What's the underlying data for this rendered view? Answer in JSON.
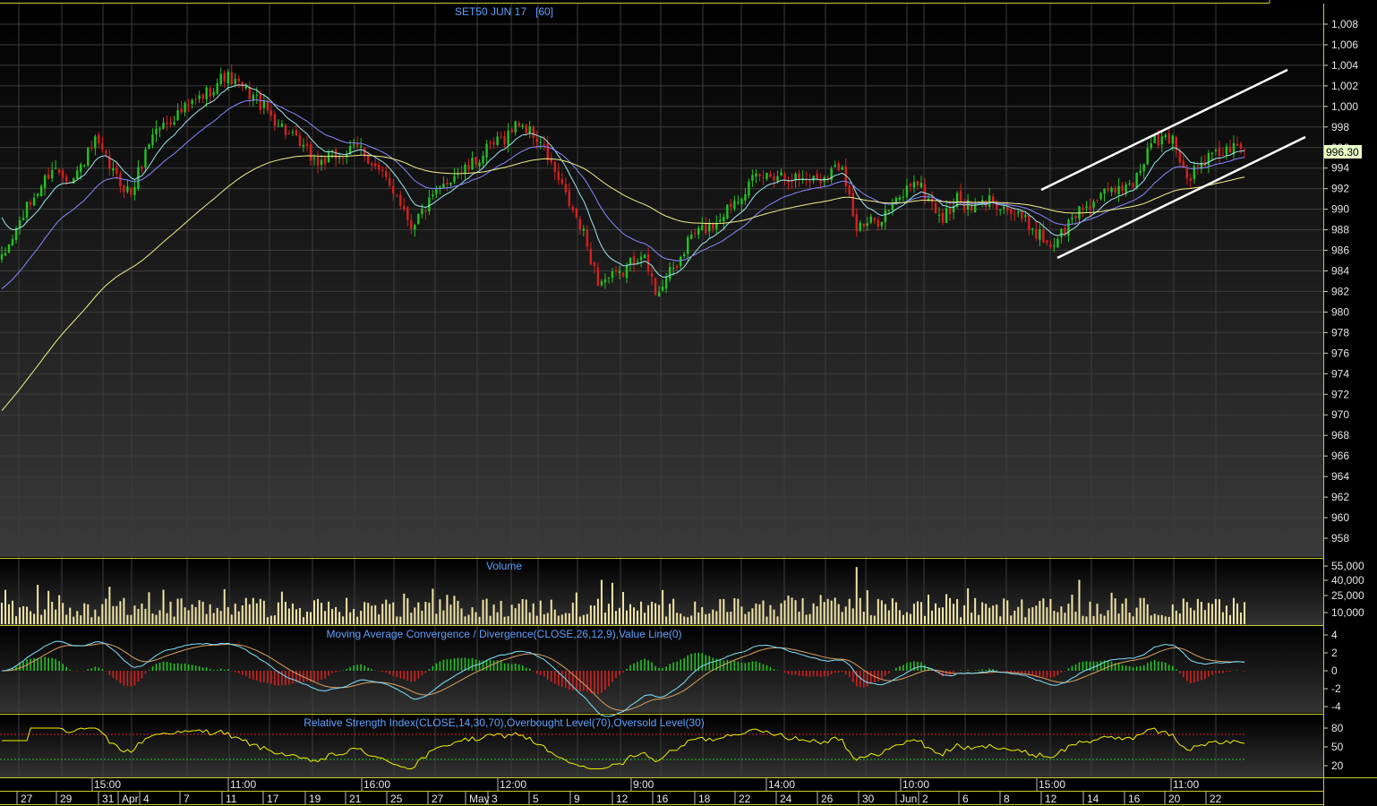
{
  "colors": {
    "background_top": "#000000",
    "background_bottom": "#3a3a3a",
    "up_candle": "#22c322",
    "down_candle": "#d61f1f",
    "grid": "#3c3c3c",
    "panel_border": "#cccc33",
    "title": "#5fa0ff",
    "ma_short": "#9ee7ef",
    "ma_mid": "#8888ff",
    "ma_long": "#f0f08a",
    "channel": "#ffffff",
    "volume": "#f2e6a6",
    "rsi": "#f0f000",
    "rsi_overbought": "#d61f1f",
    "rsi_oversold": "#22c322",
    "price_tag_bg": "#eaffc8"
  },
  "chart_data": [
    {
      "type": "candlestick",
      "title": "SET50 JUN 17   [60]",
      "ylim": [
        956.5,
        1009
      ],
      "y_ticks": [
        "1,008",
        "1,006",
        "1,004",
        "1,002",
        "1,000",
        "998",
        "996",
        "994",
        "992",
        "990",
        "988",
        "986",
        "984",
        "982",
        "980",
        "978",
        "976",
        "974",
        "972",
        "970",
        "968",
        "966",
        "964",
        "962",
        "960",
        "958"
      ],
      "last_price_label": "996.30",
      "close_path": [
        [
          0,
          985
        ],
        [
          6,
          989.5
        ],
        [
          14,
          994
        ],
        [
          20,
          993
        ],
        [
          26,
          996.5
        ],
        [
          32,
          993
        ],
        [
          36,
          991.5
        ],
        [
          42,
          997.5
        ],
        [
          50,
          999.5
        ],
        [
          56,
          1001
        ],
        [
          62,
          1003
        ],
        [
          70,
          1001
        ],
        [
          74,
          999.5
        ],
        [
          82,
          996.5
        ],
        [
          88,
          994.5
        ],
        [
          96,
          995.5
        ],
        [
          100,
          996
        ],
        [
          104,
          994
        ],
        [
          110,
          991.5
        ],
        [
          114,
          988.5
        ],
        [
          120,
          991
        ],
        [
          126,
          993.5
        ],
        [
          130,
          994
        ],
        [
          136,
          996
        ],
        [
          140,
          997
        ],
        [
          144,
          998.5
        ],
        [
          150,
          996.5
        ],
        [
          156,
          992
        ],
        [
          162,
          987.5
        ],
        [
          166,
          983
        ],
        [
          172,
          983.5
        ],
        [
          178,
          986
        ],
        [
          182,
          982
        ],
        [
          188,
          984.5
        ],
        [
          192,
          987.5
        ],
        [
          198,
          988.5
        ],
        [
          204,
          991
        ],
        [
          210,
          993
        ],
        [
          216,
          993.5
        ],
        [
          222,
          993
        ],
        [
          228,
          993
        ],
        [
          234,
          994.5
        ],
        [
          238,
          988
        ],
        [
          244,
          989
        ],
        [
          250,
          991
        ],
        [
          254,
          993
        ],
        [
          258,
          991
        ],
        [
          262,
          989
        ],
        [
          266,
          991
        ],
        [
          270,
          990
        ],
        [
          276,
          991
        ],
        [
          280,
          990
        ],
        [
          286,
          988.5
        ],
        [
          292,
          986.5
        ],
        [
          296,
          988
        ],
        [
          300,
          990
        ],
        [
          308,
          991.5
        ],
        [
          316,
          993
        ],
        [
          320,
          996.5
        ],
        [
          326,
          997
        ],
        [
          330,
          993
        ],
        [
          336,
          995
        ],
        [
          342,
          995.8
        ],
        [
          346,
          996.3
        ]
      ],
      "bars": 347,
      "moving_averages": [
        {
          "key": "ma_short",
          "period": 10
        },
        {
          "key": "ma_mid",
          "period": 25
        },
        {
          "key": "ma_long",
          "period": 75
        }
      ],
      "channel_lines": [
        {
          "x1": 1163,
          "y1": 212,
          "x2": 1438,
          "y2": 78
        },
        {
          "x1": 1181,
          "y1": 288,
          "x2": 1458,
          "y2": 153
        }
      ]
    },
    {
      "type": "bar",
      "title": "Volume",
      "y_ticks": [
        "55,000",
        "40,000",
        "25,000",
        "10,000"
      ],
      "ylim": [
        0,
        60000
      ],
      "base": 10000,
      "spikes": [
        [
          10,
          40000
        ],
        [
          30,
          38000
        ],
        [
          45,
          35000
        ],
        [
          78,
          33000
        ],
        [
          120,
          36000
        ],
        [
          167,
          45000
        ],
        [
          170,
          42000
        ],
        [
          238,
          58000
        ],
        [
          300,
          45000
        ],
        [
          258,
          30000
        ]
      ]
    },
    {
      "type": "line",
      "title": "Moving Average Convergence / Divergence(CLOSE,26,12,9),Value Line(0)",
      "y_ticks": [
        "4",
        "2",
        "0",
        "-2",
        "-4"
      ],
      "ylim": [
        -4.5,
        4.5
      ]
    },
    {
      "type": "line",
      "title": "Relative Strength Index(CLOSE,14,30,70),Overbought Level(70),Oversold Level(30)",
      "y_ticks": [
        "80",
        "50",
        "20"
      ],
      "ylim": [
        0,
        100
      ],
      "overbought": 70,
      "oversold": 30
    }
  ],
  "x_axis": {
    "time_labels": [
      "15:00",
      "11:00",
      "16:00",
      "12:00",
      "9:00",
      "14:00",
      "10:00",
      "15:00",
      "11:00"
    ],
    "date_labels": [
      "27",
      "29",
      "31",
      "Apr",
      "4",
      "7",
      "11",
      "17",
      "19",
      "21",
      "25",
      "27",
      "May",
      "3",
      "5",
      "9",
      "12",
      "16",
      "18",
      "22",
      "24",
      "26",
      "30",
      "Jun",
      "2",
      "6",
      "8",
      "12",
      "14",
      "16",
      "20",
      "22"
    ]
  }
}
